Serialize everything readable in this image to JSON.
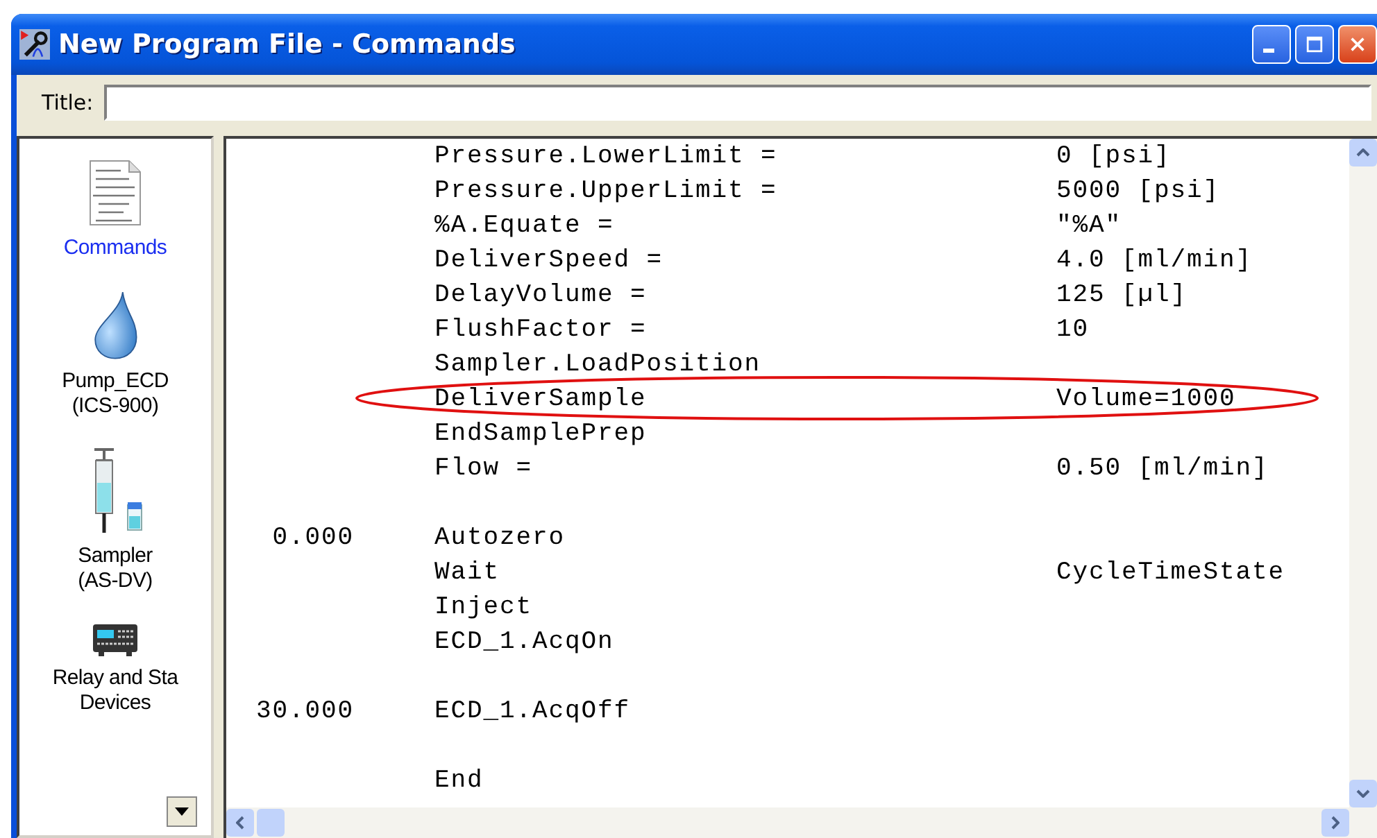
{
  "window": {
    "title": "New Program File - Commands"
  },
  "title_field": {
    "label": "Title:"
  },
  "sidebar": {
    "items": [
      {
        "kind": "document",
        "lines": [
          "Commands"
        ],
        "selected": true
      },
      {
        "kind": "drop",
        "lines": [
          "Pump_ECD",
          "(ICS-900)"
        ],
        "selected": false
      },
      {
        "kind": "syringe",
        "lines": [
          "Sampler",
          "(AS-DV)"
        ],
        "selected": false
      },
      {
        "kind": "device",
        "lines": [
          "Relay and Sta",
          "Devices"
        ],
        "selected": false
      }
    ]
  },
  "program": {
    "rows": [
      {
        "kind": "line",
        "command": "Pressure.LowerLimit =",
        "value": "0 [psi]",
        "circled": false
      },
      {
        "kind": "line",
        "command": "Pressure.UpperLimit =",
        "value": "5000 [psi]",
        "circled": false
      },
      {
        "kind": "line",
        "command": "%A.Equate =",
        "value": "\"%A\"",
        "circled": false
      },
      {
        "kind": "line",
        "command": "DeliverSpeed =",
        "value": "4.0 [ml/min]",
        "circled": false
      },
      {
        "kind": "line",
        "command": "DelayVolume =",
        "value": "125 [µl]",
        "circled": false
      },
      {
        "kind": "line",
        "command": "FlushFactor =",
        "value": "10",
        "circled": false
      },
      {
        "kind": "line",
        "command": "Sampler.LoadPosition",
        "circled": false
      },
      {
        "kind": "line",
        "command": "DeliverSample",
        "value": "Volume=1000",
        "circled": true
      },
      {
        "kind": "line",
        "command": "EndSamplePrep",
        "circled": false
      },
      {
        "kind": "line",
        "command": "Flow =",
        "value": "0.50 [ml/min]",
        "circled": false
      },
      {
        "kind": "blank"
      },
      {
        "kind": "line",
        "time": "0.000",
        "command": "Autozero",
        "circled": false
      },
      {
        "kind": "line",
        "command": "Wait",
        "value": "CycleTimeState",
        "circled": false
      },
      {
        "kind": "line",
        "command": "Inject",
        "circled": false
      },
      {
        "kind": "line",
        "command": "ECD_1.AcqOn",
        "circled": false
      },
      {
        "kind": "blank"
      },
      {
        "kind": "line",
        "time": "30.000",
        "command": "ECD_1.AcqOff",
        "circled": false
      },
      {
        "kind": "blank"
      },
      {
        "kind": "line",
        "command": "End",
        "circled": false
      }
    ]
  }
}
